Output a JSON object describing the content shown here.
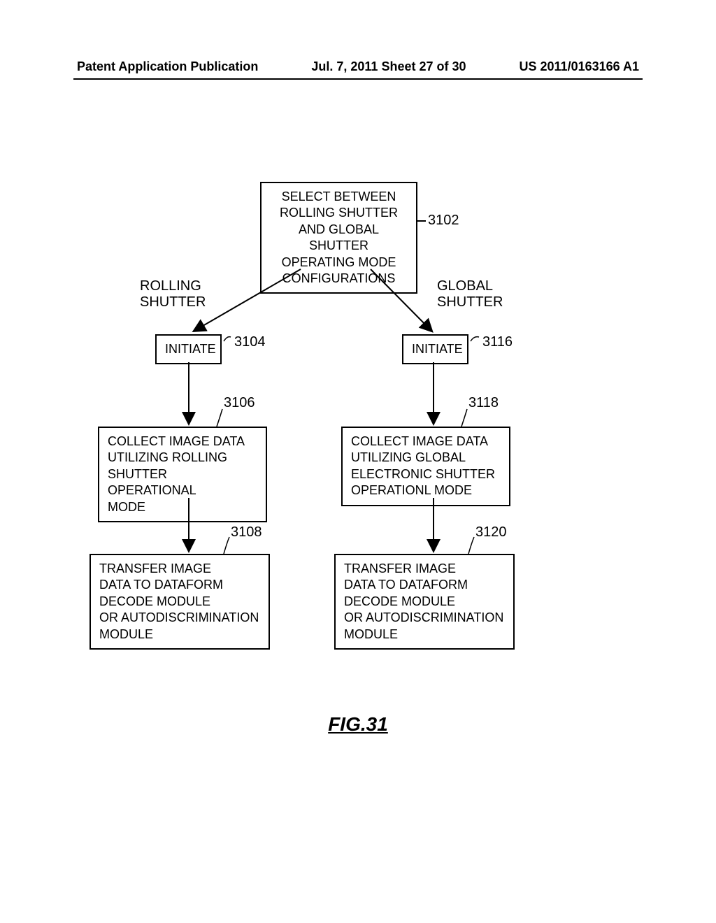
{
  "header": {
    "left": "Patent Application Publication",
    "center": "Jul. 7, 2011  Sheet 27 of 30",
    "right": "US 2011/0163166 A1"
  },
  "boxes": {
    "select": "SELECT BETWEEN\nROLLING SHUTTER\nAND GLOBAL SHUTTER\nOPERATING MODE\nCONFIGURATIONS",
    "rolling_label": "ROLLING\nSHUTTER",
    "global_label": "GLOBAL\nSHUTTER",
    "initiate_left": "INITIATE",
    "initiate_right": "INITIATE",
    "collect_left": "COLLECT IMAGE DATA\nUTILIZING ROLLING\nSHUTTER OPERATIONAL\nMODE",
    "collect_right": "COLLECT IMAGE DATA\nUTILIZING GLOBAL\nELECTRONIC SHUTTER\nOPERATIONL MODE",
    "transfer_left": "TRANSFER IMAGE\nDATA TO DATAFORM\nDECODE MODULE\nOR AUTODISCRIMINATION\nMODULE",
    "transfer_right": "TRANSFER IMAGE\nDATA TO DATAFORM\nDECODE MODULE\nOR AUTODISCRIMINATION\nMODULE"
  },
  "refs": {
    "r3102": "3102",
    "r3104": "3104",
    "r3116": "3116",
    "r3106": "3106",
    "r3118": "3118",
    "r3108": "3108",
    "r3120": "3120"
  },
  "figure": "FIG.31"
}
